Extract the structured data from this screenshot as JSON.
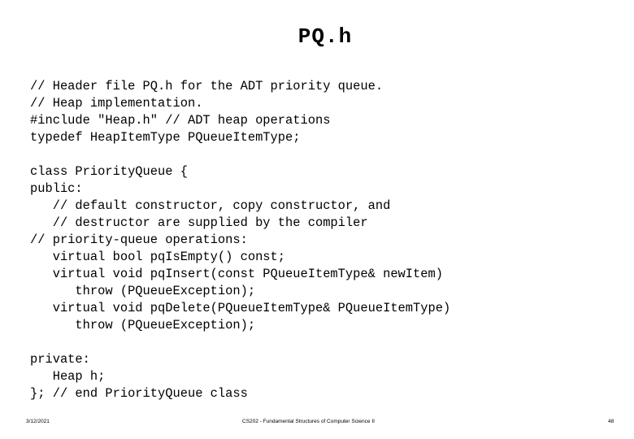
{
  "slide": {
    "title": "PQ.h",
    "code_lines": [
      "// Header file PQ.h for the ADT priority queue.",
      "// Heap implementation.",
      "#include \"Heap.h\" // ADT heap operations",
      "typedef HeapItemType PQueueItemType;",
      "",
      "class PriorityQueue {",
      "public:",
      "   // default constructor, copy constructor, and",
      "   // destructor are supplied by the compiler",
      "// priority-queue operations:",
      "   virtual bool pqIsEmpty() const;",
      "   virtual void pqInsert(const PQueueItemType& newItem)",
      "      throw (PQueueException);",
      "   virtual void pqDelete(PQueueItemType& PQueueItemType)",
      "      throw (PQueueException);",
      "",
      "private:",
      "   Heap h;",
      "}; // end PriorityQueue class"
    ]
  },
  "footer": {
    "date": "3/12/2021",
    "course": "CS202 - Fundamental Structures of Computer Science II",
    "page": "48"
  }
}
